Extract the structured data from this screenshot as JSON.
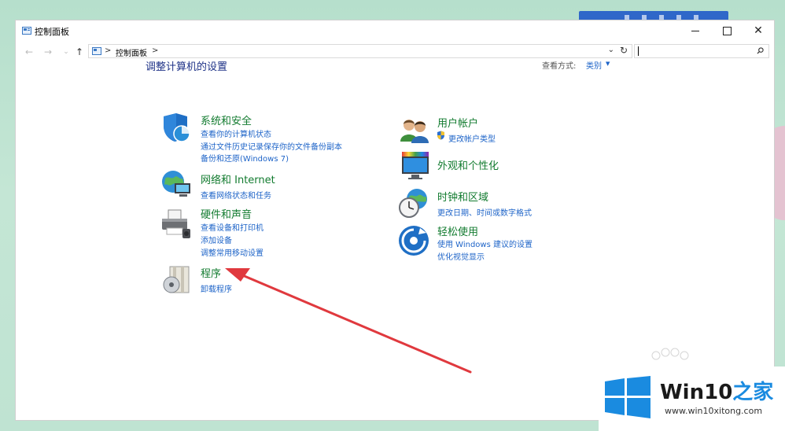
{
  "window": {
    "title": "控制面板",
    "controls": {
      "minimize": "—",
      "maximize": "☐",
      "close": "✕"
    }
  },
  "address": {
    "path": "控制面板",
    "separator": ">",
    "search_placeholder": ""
  },
  "main": {
    "heading": "调整计算机的设置",
    "view_by_label": "查看方式:",
    "view_by_value": "类别"
  },
  "categories": [
    {
      "title": "系统和安全",
      "icon": "shield-icon",
      "links": [
        "查看你的计算机状态",
        "通过文件历史记录保存你的文件备份副本",
        "备份和还原(Windows 7)"
      ]
    },
    {
      "title": "网络和 Internet",
      "icon": "network-globe-icon",
      "links": [
        "查看网络状态和任务"
      ]
    },
    {
      "title": "硬件和声音",
      "icon": "printer-icon",
      "links": [
        "查看设备和打印机",
        "添加设备",
        "调整常用移动设置"
      ]
    },
    {
      "title": "程序",
      "icon": "programs-disc-icon",
      "links": [
        "卸载程序"
      ]
    },
    {
      "title": "用户帐户",
      "icon": "users-icon",
      "links": [
        "更改帐户类型"
      ]
    },
    {
      "title": "外观和个性化",
      "icon": "monitor-icon",
      "links": []
    },
    {
      "title": "时钟和区域",
      "icon": "clock-globe-icon",
      "links": [
        "更改日期、时间或数字格式"
      ]
    },
    {
      "title": "轻松使用",
      "icon": "ease-of-access-icon",
      "links": [
        "使用 Windows 建议的设置",
        "优化视觉显示"
      ]
    }
  ],
  "watermark": {
    "brand_main": "Win10",
    "brand_accent": "之家",
    "url": "www.win10xitong.com"
  },
  "colors": {
    "category_title": "#127b2f",
    "link": "#1e64c8",
    "heading": "#1e3287",
    "arrow": "#e0393e",
    "logo_blue": "#1a8be0"
  }
}
